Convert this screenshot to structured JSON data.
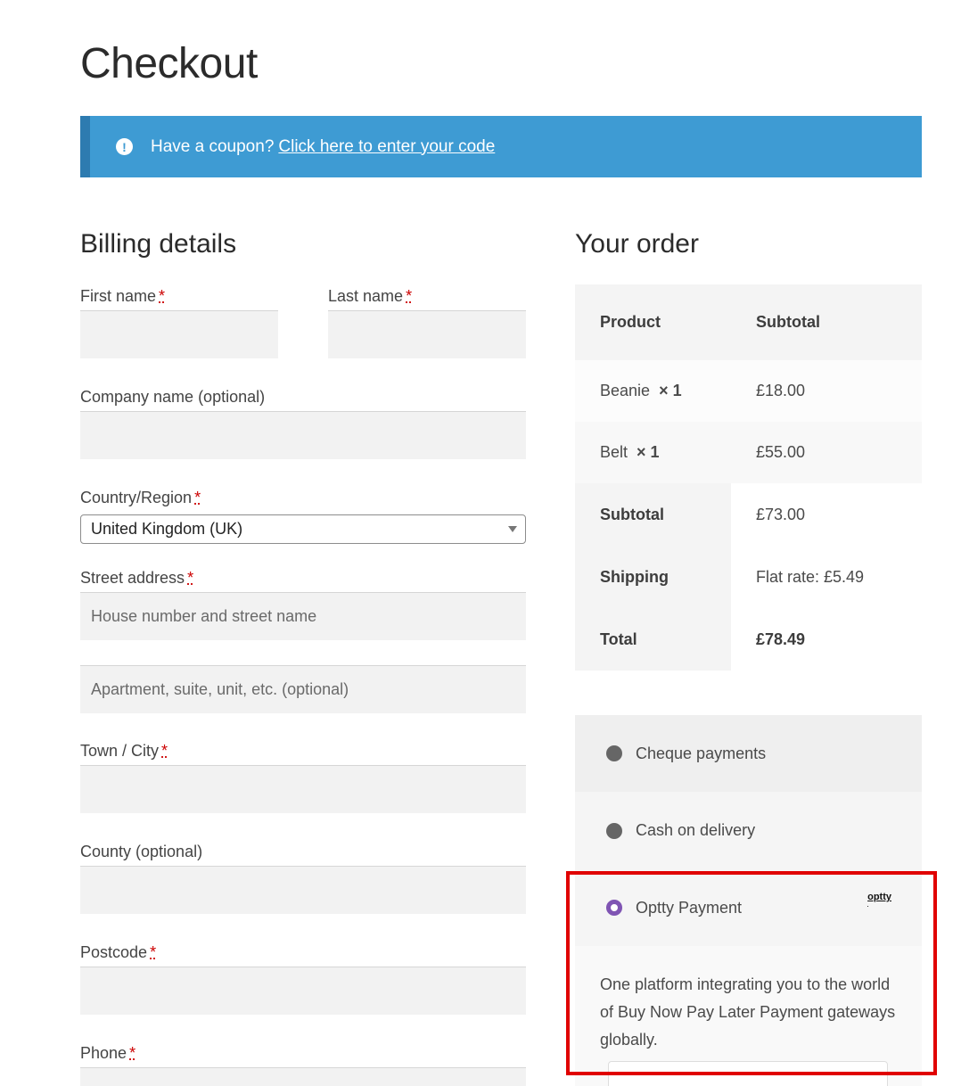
{
  "page": {
    "title": "Checkout"
  },
  "coupon": {
    "prompt": "Have a coupon?",
    "link": "Click here to enter your code"
  },
  "billing": {
    "heading": "Billing details",
    "required_mark": "*",
    "first_name_label": "First name",
    "last_name_label": "Last name",
    "company_label": "Company name (optional)",
    "country_label": "Country/Region",
    "country_value": "United Kingdom (UK)",
    "street_label": "Street address",
    "street_placeholder": "House number and street name",
    "apartment_placeholder": "Apartment, suite, unit, etc. (optional)",
    "town_label": "Town / City",
    "county_label": "County (optional)",
    "postcode_label": "Postcode",
    "phone_label": "Phone"
  },
  "order": {
    "heading": "Your order",
    "columns": [
      "Product",
      "Subtotal"
    ],
    "items": [
      {
        "name": "Beanie",
        "qty": "× 1",
        "price": "£18.00"
      },
      {
        "name": "Belt",
        "qty": "× 1",
        "price": "£55.00"
      }
    ],
    "subtotal_label": "Subtotal",
    "subtotal_value": "£73.00",
    "shipping_label": "Shipping",
    "shipping_value": "Flat rate: £5.49",
    "total_label": "Total",
    "total_value": "£78.49"
  },
  "payment": {
    "methods": [
      {
        "label": "Cheque payments",
        "selected": false
      },
      {
        "label": "Cash on delivery",
        "selected": false
      },
      {
        "label": "Optty Payment",
        "selected": true
      }
    ],
    "optty_logo_text": "optty",
    "optty_description": "One platform integrating you to the world of Buy Now Pay Later Payment gateways globally."
  },
  "colors": {
    "accent": "#3e9bd3",
    "radio_selected": "#7f54b3",
    "highlight": "#e00000"
  }
}
